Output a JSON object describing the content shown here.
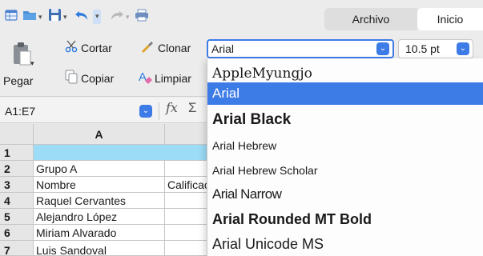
{
  "ribbon_tabs": {
    "archivo": "Archivo",
    "inicio": "Inicio"
  },
  "clipboard": {
    "cut": "Cortar",
    "copy": "Copiar",
    "paste": "Pegar",
    "clone": "Clonar",
    "clear": "Limpiar"
  },
  "font": {
    "current": "Arial",
    "size": "10.5 pt"
  },
  "formula": {
    "name_box": "A1:E7",
    "fx": "fx",
    "sum": "Σ"
  },
  "grid": {
    "columns": [
      "A"
    ],
    "rows": [
      "1",
      "2",
      "3",
      "4",
      "5",
      "6",
      "7"
    ],
    "cells": {
      "a2": "Grupo A",
      "a3": "Nombre",
      "b3": "Calificación",
      "a4": "Raquel Cervantes",
      "a5": "Alejandro López",
      "a6": "Miriam Alvarado",
      "a7": "Luis Sandoval"
    }
  },
  "font_list": [
    "AppleMyungjo",
    "Arial",
    "Arial Black",
    "Arial Hebrew",
    "Arial Hebrew Scholar",
    "Arial Narrow",
    "Arial Rounded MT Bold",
    "Arial Unicode MS"
  ],
  "colors": {
    "accent": "#3d7be6",
    "selection_fill": "#9cdcf6",
    "undo_blue": "#2e7be0",
    "save_blue": "#3f6fb0",
    "folder_blue": "#4a90d9"
  },
  "icons": {
    "new": "spreadsheet-icon",
    "open": "folder-icon",
    "save": "save-icon",
    "undo": "undo-icon",
    "redo": "redo-icon",
    "print": "print-icon",
    "paste": "clipboard-icon",
    "cut": "scissors-icon",
    "copy": "copy-icon",
    "clone": "brush-icon",
    "clear": "eraser-icon"
  }
}
